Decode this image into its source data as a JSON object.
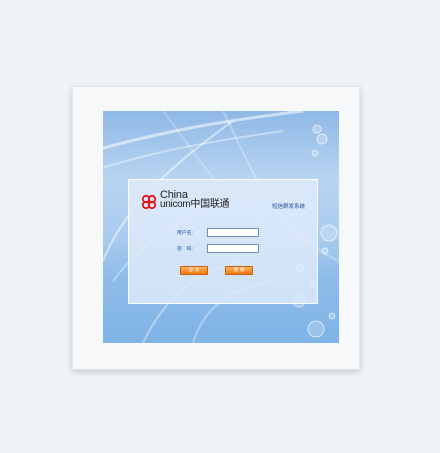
{
  "login": {
    "brand_line1": "China",
    "brand_line2": "unicom中国联通",
    "system_title": "短信群发系统",
    "username_label": "用户名:",
    "password_label": "密　码:",
    "username_value": "",
    "password_value": "",
    "login_button": "登 录",
    "reset_button": "重 填"
  },
  "colors": {
    "accent": "#f07a14",
    "label": "#1f4fa8",
    "logo_red": "#e0151b"
  },
  "icons": [
    "china-unicom-knot-icon"
  ]
}
